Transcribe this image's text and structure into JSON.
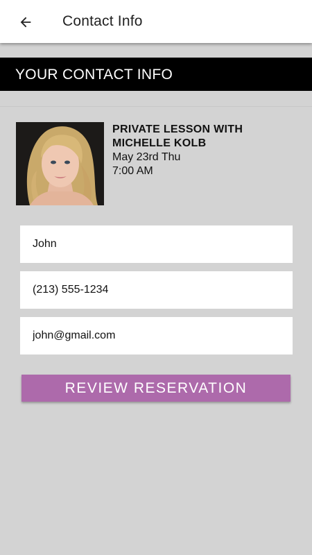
{
  "appbar": {
    "title": "Contact Info",
    "back_icon": "arrow-left-icon"
  },
  "section": {
    "title": "YOUR CONTACT INFO"
  },
  "event": {
    "name": "PRIVATE LESSON WITH MICHELLE KOLB",
    "date": "May 23rd Thu",
    "time": "7:00 AM"
  },
  "form": {
    "name_value": "John",
    "phone_value": "(213) 555-1234",
    "email_value": "john@gmail.com"
  },
  "actions": {
    "review_label": "REVIEW RESERVATION"
  },
  "colors": {
    "background": "#d3d3d3",
    "band": "#000000",
    "accent": "#ad6aab"
  }
}
